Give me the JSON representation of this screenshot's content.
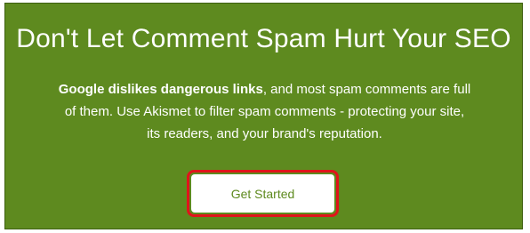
{
  "banner": {
    "title": "Don't Let Comment Spam Hurt Your SEO",
    "description_bold": "Google dislikes dangerous links",
    "description_rest_line1": ", and most spam comments are full",
    "description_line2": "of them. Use Akismet to filter spam comments - protecting your site,",
    "description_line3": "its readers, and your brand's reputation.",
    "cta_label": "Get Started"
  },
  "colors": {
    "banner_background": "#5e8a1f",
    "highlight_outline": "#e0141b",
    "button_background": "#ffffff"
  }
}
